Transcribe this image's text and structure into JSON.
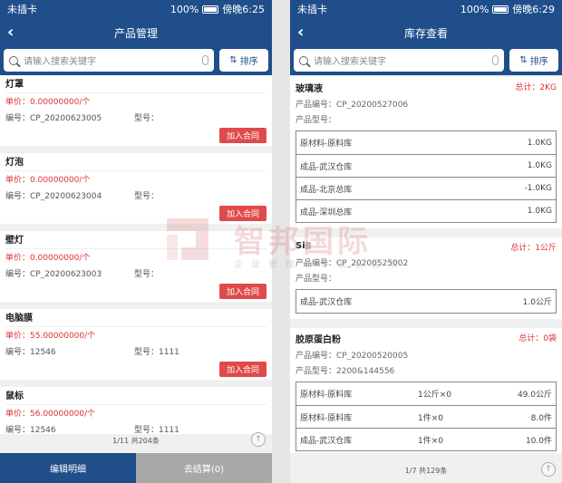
{
  "left": {
    "status": {
      "carrier": "未插卡",
      "battery": "100%",
      "time": "傍晚6:25"
    },
    "nav": {
      "title": "产品管理"
    },
    "search": {
      "placeholder": "请输入搜索关键字",
      "sort_label": "排序"
    },
    "products": [
      {
        "name": "灯罩",
        "price": "单价：0.00000000/个",
        "code": "编号：CP_20200623005",
        "model": "型号：",
        "add": "加入合同"
      },
      {
        "name": "灯泡",
        "price": "单价：0.00000000/个",
        "code": "编号：CP_20200623004",
        "model": "型号：",
        "add": "加入合同"
      },
      {
        "name": "壁灯",
        "price": "单价：0.00000000/个",
        "code": "编号：CP_20200623003",
        "model": "型号：",
        "add": "加入合同"
      },
      {
        "name": "电脑膜",
        "price": "单价：55.00000000/个",
        "code": "编号：12546",
        "model": "型号：1111",
        "add": "加入合同"
      },
      {
        "name": "鼠标",
        "price": "单价：56.00000000/个",
        "code": "编号：12546",
        "model": "型号：1111",
        "add": ""
      }
    ],
    "pager": "1/11 共204条",
    "bottom": {
      "edit": "编辑明细",
      "checkout": "去结算(0)"
    }
  },
  "right": {
    "status": {
      "carrier": "未插卡",
      "battery": "100%",
      "time": "傍晚6:29"
    },
    "nav": {
      "title": "库存查看"
    },
    "search": {
      "placeholder": "请输入搜索关键字",
      "sort_label": "排序"
    },
    "items": [
      {
        "name": "玻璃液",
        "total": "总计：2KG",
        "code": "产品编号：CP_20200527006",
        "model": "产品型号：",
        "rows": [
          {
            "loc": "原材料-原料库",
            "mid": "",
            "qty": "1.0KG"
          },
          {
            "loc": "成品-武汉仓库",
            "mid": "",
            "qty": "1.0KG"
          },
          {
            "loc": "成品-北京总库",
            "mid": "",
            "qty": "-1.0KG"
          },
          {
            "loc": "成品-深圳总库",
            "mid": "",
            "qty": "1.0KG"
          }
        ]
      },
      {
        "name": "Si",
        "total": "总计：1公斤",
        "code": "产品编号：CP_20200525002",
        "model": "产品型号：",
        "rows": [
          {
            "loc": "成品-武汉仓库",
            "mid": "",
            "qty": "1.0公斤"
          }
        ]
      },
      {
        "name": "胶原蛋白粉",
        "total": "总计：0袋",
        "code": "产品编号：CP_20200520005",
        "model": "产品型号：2200&144556",
        "rows": [
          {
            "loc": "原材料-原料库",
            "mid": "1公斤×0",
            "qty": "49.0公斤"
          },
          {
            "loc": "原材料-原料库",
            "mid": "1件×0",
            "qty": "8.0件"
          },
          {
            "loc": "成品-武汉仓库",
            "mid": "1件×0",
            "qty": "10.0件"
          }
        ]
      }
    ],
    "pager": "1/7 共129条"
  },
  "watermark": {
    "title": "智邦国际",
    "subtitle": "企业管理软件著名品牌"
  },
  "colors": {
    "primary": "#1f4e8a",
    "price_red": "#e03030",
    "add_button": "#e04a4a",
    "checkout_gray": "#a8a8a8"
  }
}
